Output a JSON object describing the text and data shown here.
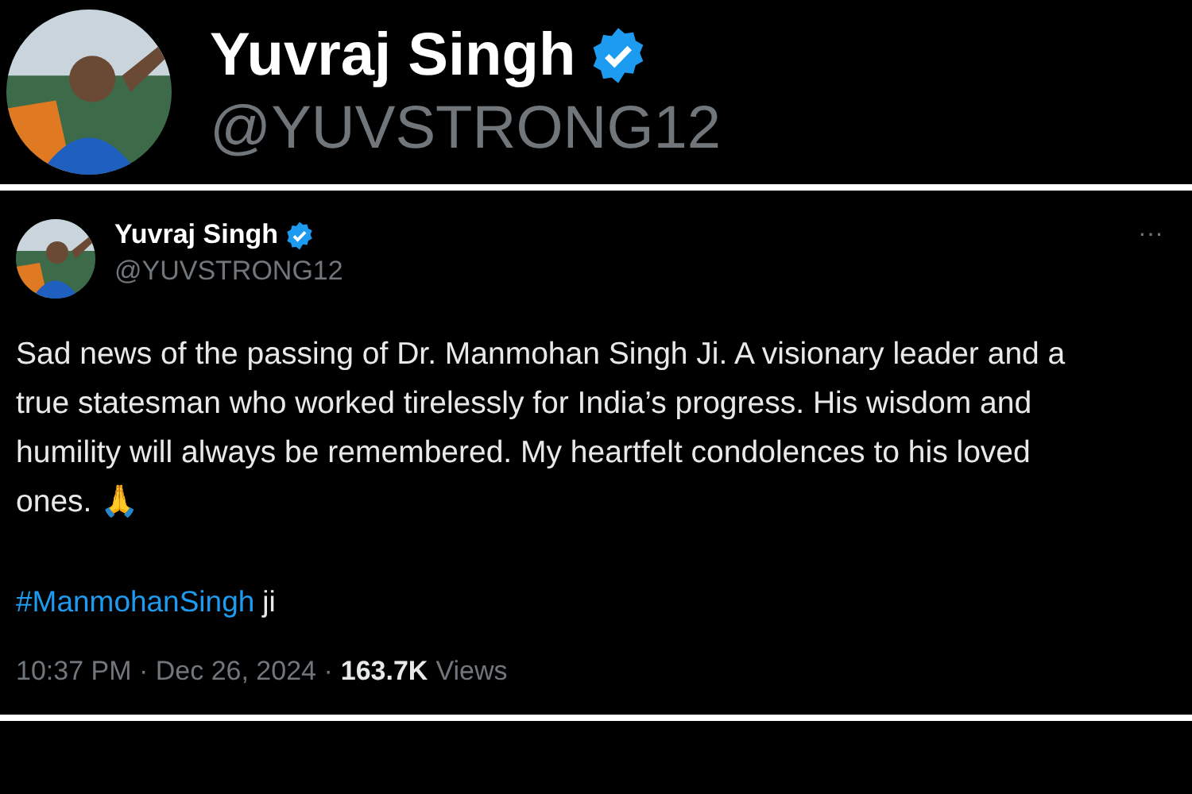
{
  "header": {
    "name": "Yuvraj Singh",
    "verified": true,
    "handle": "@YUVSTRONG12"
  },
  "tweet": {
    "name": "Yuvraj Singh",
    "verified": true,
    "handle": "@YUVSTRONG12",
    "menu": "···",
    "text": "Sad news of the passing of Dr. Manmohan Singh Ji. A visionary leader and a true statesman who worked tirelessly for India’s progress. His wisdom and humility will always be remembered. My heartfelt condolences to his loved ones. 🙏",
    "hashtag": "#ManmohanSingh",
    "hashtag_suffix": "ji",
    "time": "10:37 PM · Dec 26, 2024 ·",
    "views_count": "163.7K",
    "views_label": "Views"
  }
}
